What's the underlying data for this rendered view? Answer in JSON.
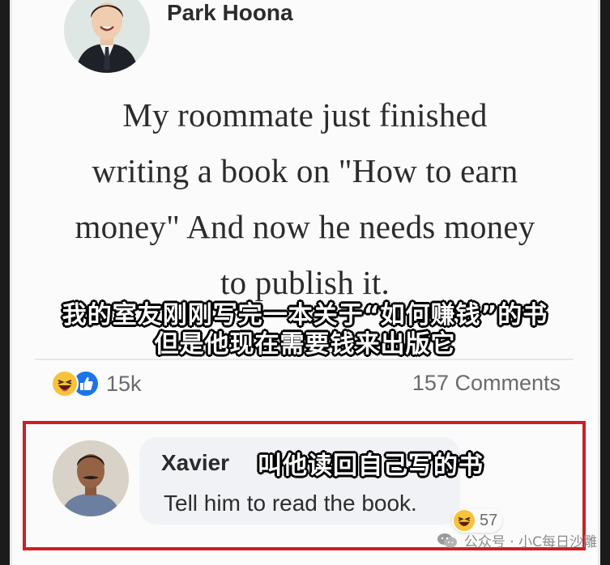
{
  "post": {
    "author": "Park Hoona",
    "text_lines": [
      "My roommate just finished",
      "writing a book on \"How to earn",
      "money\" And now he needs money",
      "to publish it."
    ],
    "subtitle_lines": [
      "我的室友刚刚写完一本关于“如何赚钱”的书",
      "但是他现在需要钱来出版它"
    ],
    "reaction_icons": [
      "haha-emoji-icon",
      "like-thumb-icon"
    ],
    "reaction_count": "15k",
    "comments_count": "157 Comments"
  },
  "comment": {
    "author": "Xavier",
    "author_subtitle": "叫他读回自己写的书",
    "text": "Tell him to read the book.",
    "reaction_icon": "haha-emoji-icon",
    "reaction_count": "57",
    "highlight_color": "#cc1f25"
  },
  "watermark": {
    "icon": "wechat-icon",
    "text": "公众号 · 小C每日沙雕"
  },
  "colors": {
    "like_blue": "#1d74e8",
    "haha_yellow": "#f6c33a"
  }
}
